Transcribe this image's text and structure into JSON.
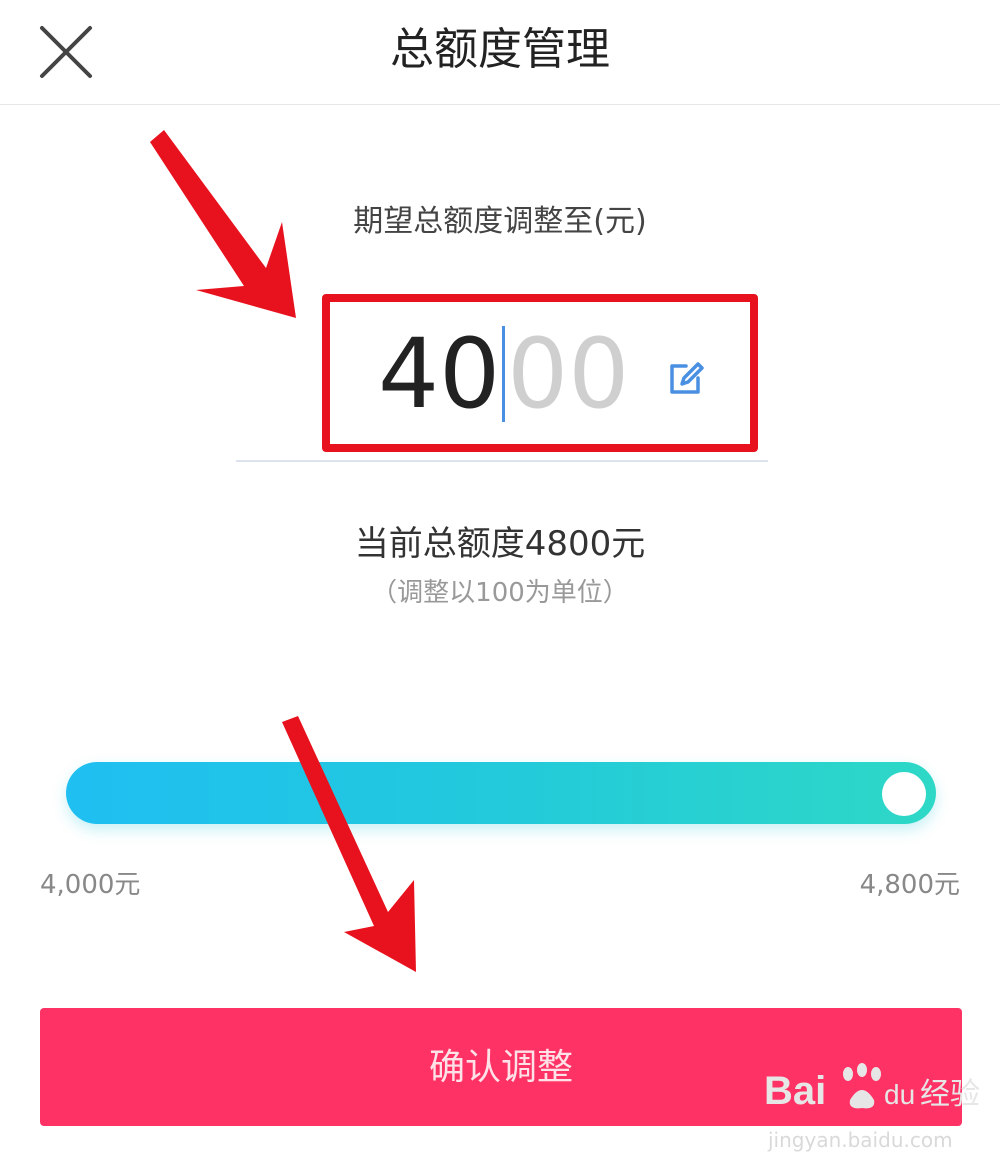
{
  "header": {
    "title": "总额度管理",
    "close_icon": "close-icon"
  },
  "main": {
    "subtitle": "期望总额度调整至(元)",
    "amount": {
      "typed": "40",
      "ghost": "00",
      "edit_icon": "edit-icon"
    },
    "current_total": "当前总额度4800元",
    "unit_hint": "（调整以100为单位）"
  },
  "slider": {
    "min_label": "4,000元",
    "max_label": "4,800元",
    "value_fraction": 1.0,
    "gradient_start": "#1fbff2",
    "gradient_end": "#2ed8c6"
  },
  "footer": {
    "confirm_label": "确认调整",
    "confirm_color": "#ff3265"
  },
  "overlay": {
    "highlight_color": "#e8121e",
    "arrow_color": "#e8121e"
  },
  "watermark": {
    "logo_text_left": "Bai",
    "logo_text_right": "du",
    "logo_cn": "经验",
    "url": "jingyan.baidu.com"
  }
}
